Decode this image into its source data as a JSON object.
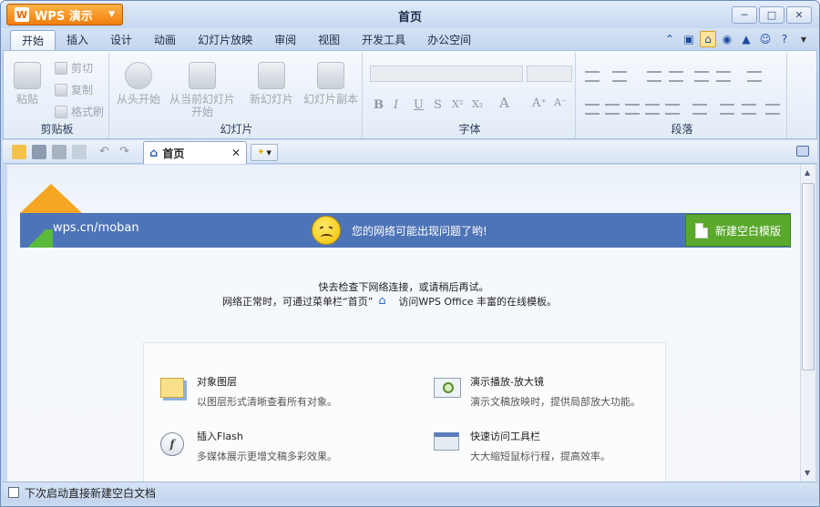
{
  "app": {
    "name": "WPS 演示",
    "window_title": "首页"
  },
  "menu_tabs": [
    "开始",
    "插入",
    "设计",
    "动画",
    "幻灯片放映",
    "审阅",
    "视图",
    "开发工具",
    "办公空间"
  ],
  "active_tab": "开始",
  "ribbon": {
    "clipboard": {
      "paste": "粘贴",
      "cut": "剪切",
      "copy": "复制",
      "format_painter": "格式刷",
      "label": "剪贴板"
    },
    "slideshow": {
      "from_start": "从头开始",
      "from_current": "从当前幻灯片开始",
      "label": "幻灯片"
    },
    "slides": {
      "new_slide": "新幻灯片",
      "copy_slide": "幻灯片副本"
    },
    "font": {
      "label": "字体",
      "bold": "B",
      "italic": "I",
      "underline": "U",
      "strike": "S",
      "super": "X²",
      "sub": "X₂",
      "format": "A",
      "grow": "A⁺",
      "shrink": "A⁻"
    },
    "paragraph": {
      "label": "段落"
    }
  },
  "doc_tab": {
    "label": "首页"
  },
  "content": {
    "site": "wps.cn/moban",
    "net_error": "您的网络可能出现问题了哟!",
    "new_blank_btn": "新建空白模版",
    "msg1": "快去检查下网络连接，或请稍后再试。",
    "msg2_prefix": "网络正常时，可通过菜单栏“首页”",
    "msg2_suffix": "访问WPS Office 丰富的在线模板。",
    "features": [
      {
        "title": "对象图层",
        "desc": "以图层形式清晰查看所有对象。",
        "icon": "layers-icon"
      },
      {
        "title": "演示播放-放大镜",
        "desc": "演示文稿放映时，提供局部放大功能。",
        "icon": "magnifier-icon"
      },
      {
        "title": "插入Flash",
        "desc": "多媒体展示更增文稿多彩效果。",
        "icon": "flash-icon"
      },
      {
        "title": "快速访问工具栏",
        "desc": "大大缩短鼠标行程，提高效率。",
        "icon": "quick-access-toolbar-icon"
      }
    ]
  },
  "status": {
    "checkbox_label": "下次启动直接新建空白文档",
    "checked": false
  },
  "colors": {
    "banner": "#4e74b8",
    "orange": "#f5a623",
    "green": "#5aa92d",
    "accent": "#f07d0c"
  }
}
